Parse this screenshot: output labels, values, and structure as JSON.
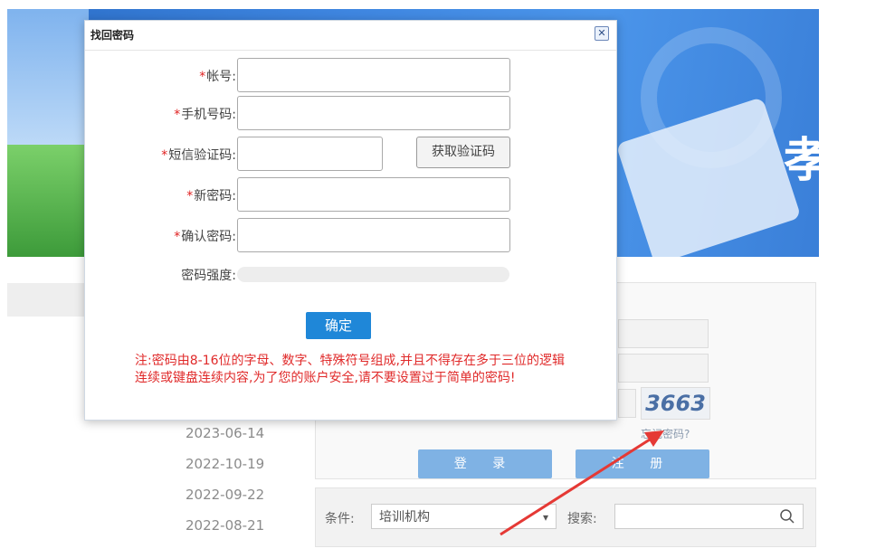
{
  "dialog": {
    "title": "找回密码",
    "close_symbol": "✕",
    "fields": {
      "account_label": "帐号:",
      "phone_label": "手机号码:",
      "sms_label": "短信验证码:",
      "new_password_label": "新密码:",
      "confirm_password_label": "确认密码:",
      "strength_label": "密码强度:"
    },
    "required_mark": "*",
    "get_code_button": "获取验证码",
    "confirm_button": "确定",
    "note": "注:密码由8-16位的字母、数字、特殊符号组成,并且不得存在多于三位的逻辑连续或键盘连续内容,为了您的账户安全,请不要设置过于简单的密码!"
  },
  "background": {
    "captcha": "3663",
    "forgot_link": "忘记密码?",
    "login_button": "登 录",
    "register_button": "注 册",
    "dates": [
      "2023-06-14",
      "2022-10-19",
      "2022-09-22",
      "2022-08-21"
    ],
    "search": {
      "condition_label": "条件:",
      "condition_value": "培训机构",
      "search_label": "搜索:"
    }
  },
  "colors": {
    "primary": "#1f87d8",
    "required": "#e02020",
    "annotation_arrow": "#e53935"
  }
}
